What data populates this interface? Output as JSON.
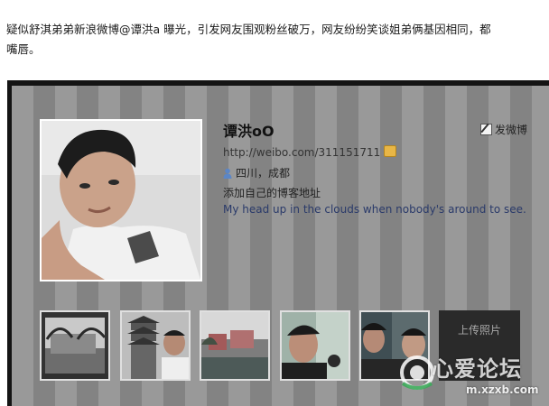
{
  "article": {
    "line1": "疑似舒淇弟弟新浪微博@谭洪a 曝光，引发网友围观粉丝破万，网友纷纷笑谈姐弟俩基因相同，都",
    "line2": "嘴唇。"
  },
  "profile": {
    "name": "谭洪oO",
    "post_label": "发微博",
    "url": "http://weibo.com/311151711",
    "location": "四川，成都",
    "blog_prompt": "添加自己的博客地址",
    "bio": "My head up in the clouds when nobody's around to see."
  },
  "gallery": {
    "upload_label": "上传照片"
  },
  "watermark": {
    "text": "心爱论坛",
    "domain": "m.xzxb.com"
  },
  "colors": {
    "frame_dark": "#141414",
    "profile_bg": "#8d8d8d",
    "upload_bg": "#2a2a2a"
  },
  "icons": [
    "pen-icon",
    "badge-icon",
    "user-icon",
    "logo-icon"
  ]
}
